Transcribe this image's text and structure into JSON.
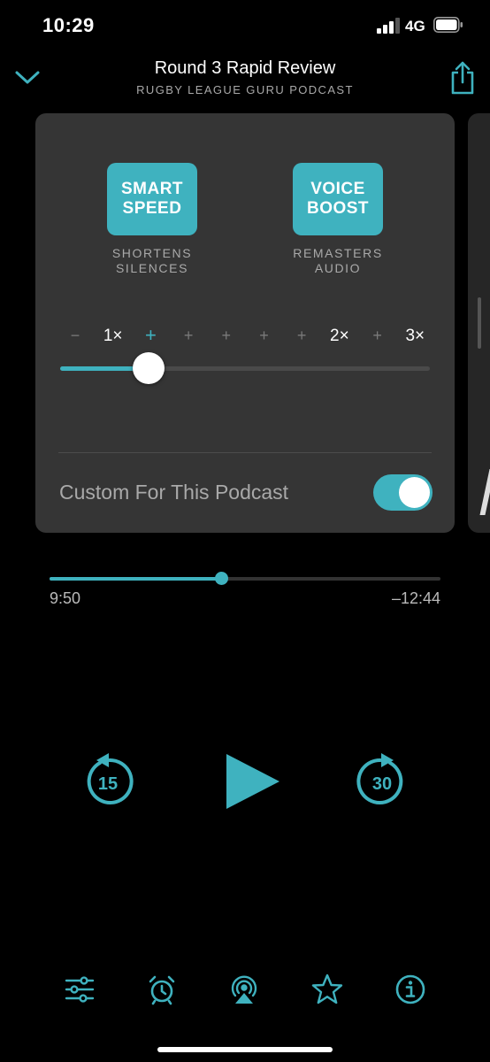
{
  "status": {
    "time": "10:29",
    "network": "4G",
    "signal_bars_filled": 3
  },
  "header": {
    "title": "Round 3 Rapid Review",
    "podcast": "RUGBY LEAGUE GURU PODCAST",
    "collapse_icon": "chevron-down-icon",
    "share_icon": "share-icon"
  },
  "effects_card": {
    "smart_speed": {
      "label": "SMART\nSPEED",
      "caption": "SHORTENS\nSILENCES"
    },
    "voice_boost": {
      "label": "VOICE\nBOOST",
      "caption": "REMASTERS\nAUDIO"
    },
    "speed": {
      "ticks": [
        "−",
        "1×",
        "+",
        "+",
        "+",
        "+",
        "+",
        "2×",
        "+",
        "3×"
      ],
      "active_tick_index": 2,
      "value_fraction": 0.24
    },
    "custom_for_podcast": {
      "label": "Custom For This Podcast",
      "enabled": true
    }
  },
  "playback": {
    "elapsed": "9:50",
    "remaining": "–12:44",
    "progress_fraction": 0.44
  },
  "transport": {
    "skip_back_seconds": "15",
    "skip_forward_seconds": "30",
    "play_icon": "play-icon"
  },
  "toolbar": {
    "items": [
      "effects-icon",
      "sleep-timer-icon",
      "airplay-icon",
      "star-icon",
      "info-icon"
    ]
  },
  "colors": {
    "accent": "#3fb2bf",
    "background": "#000000",
    "card": "#353535"
  }
}
